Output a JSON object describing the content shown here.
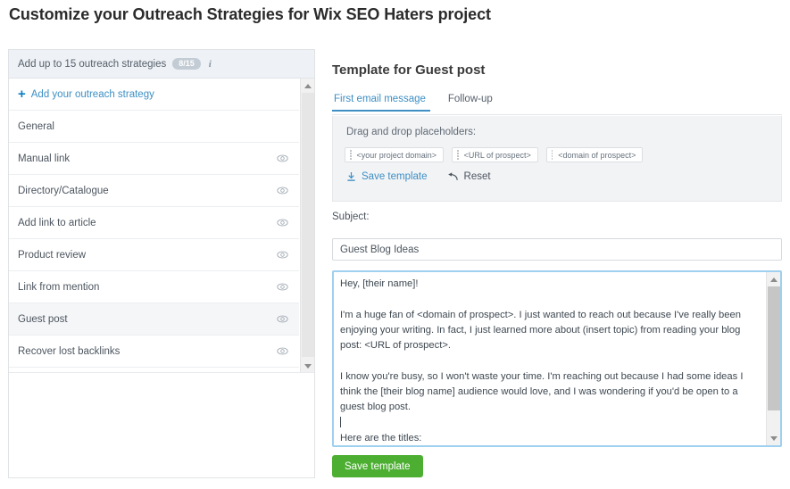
{
  "page_title": "Customize your Outreach Strategies for Wix SEO Haters project",
  "sidebar": {
    "header_text": "Add up to 15 outreach strategies",
    "count_badge": "8/15",
    "info_icon": "info-icon",
    "add_strategy_label": "Add your outreach strategy",
    "items": [
      {
        "label": "General",
        "selected": false,
        "has_eye": false
      },
      {
        "label": "Manual link",
        "selected": false,
        "has_eye": true
      },
      {
        "label": "Directory/Catalogue",
        "selected": false,
        "has_eye": true
      },
      {
        "label": "Add link to article",
        "selected": false,
        "has_eye": true
      },
      {
        "label": "Product review",
        "selected": false,
        "has_eye": true
      },
      {
        "label": "Link from mention",
        "selected": false,
        "has_eye": true
      },
      {
        "label": "Guest post",
        "selected": true,
        "has_eye": true
      },
      {
        "label": "Recover lost backlinks",
        "selected": false,
        "has_eye": true
      }
    ]
  },
  "template": {
    "title": "Template for Guest post",
    "tabs": [
      {
        "label": "First email message",
        "active": true
      },
      {
        "label": "Follow-up",
        "active": false
      }
    ],
    "placeholders_label": "Drag and drop placeholders:",
    "placeholders": [
      "<your project domain>",
      "<URL of prospect>",
      "<domain of prospect>"
    ],
    "save_template_link": "Save template",
    "reset_link": "Reset",
    "subject_label": "Subject:",
    "subject_value": "Guest Blog Ideas",
    "body_part1": "Hey, [their name]!\n\nI'm a huge fan of <domain of prospect>. I just wanted to reach out because I've really been enjoying your writing. In fact, I just learned more about (insert topic) from reading your blog post: <URL of prospect>.\n\nI know you're busy, so I won't waste your time. I'm reaching out because I had some ideas I think the [their blog name] audience would love, and I was wondering if you'd be open to a guest blog post.\n",
    "body_part2": "\nHere are the titles:\n(List Titles)",
    "save_button": "Save template"
  },
  "colors": {
    "accent_blue": "#3d8fc4",
    "save_green": "#4caf32",
    "badge_gray": "#c3ccd5"
  }
}
